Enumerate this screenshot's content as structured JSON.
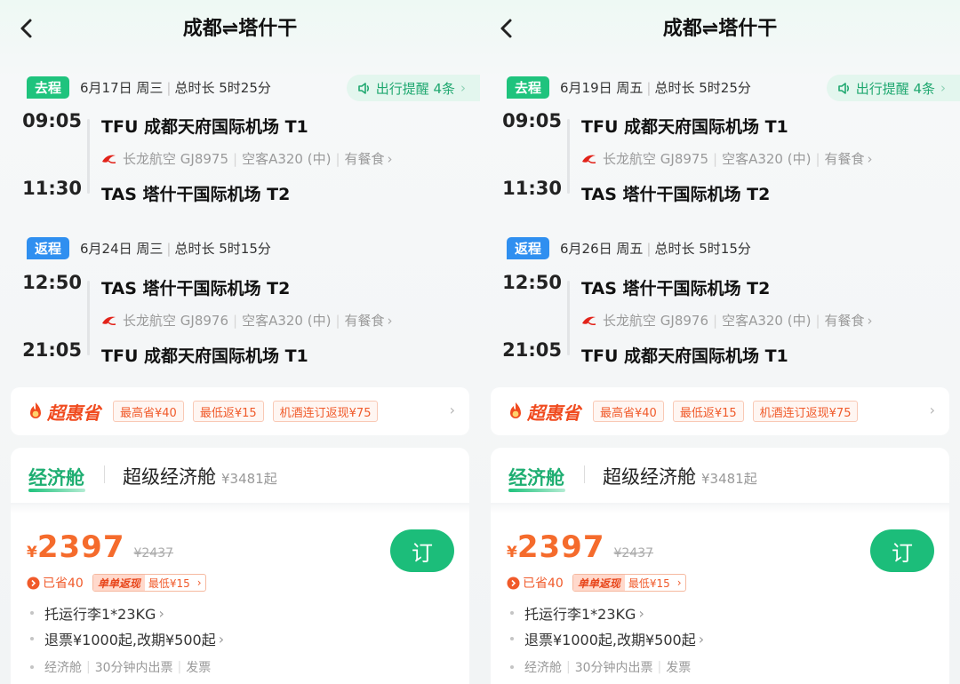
{
  "colors": {
    "go_badge": "#1fc37d",
    "return_badge": "#2f8ff0",
    "price": "#f56b2c",
    "book_button": "#1cbd7a"
  },
  "icons": {
    "back": "chevron-left-icon",
    "speaker": "speaker-icon",
    "airline": "airline-logo-icon",
    "promo": "flame-coin-icon"
  },
  "panels": [
    {
      "route_title": "成都⇌塔什干",
      "outbound": {
        "badge": "去程",
        "date": "6月17日 周三",
        "duration": "总时长 5时25分",
        "reminder": "出行提醒 4条",
        "dep_time": "09:05",
        "dep_airport": "TFU 成都天府国际机场 T1",
        "airline": "长龙航空 GJ8975",
        "aircraft": "空客A320 (中)",
        "meal": "有餐食",
        "arr_time": "11:30",
        "arr_airport": "TAS 塔什干国际机场 T2"
      },
      "inbound": {
        "badge": "返程",
        "date": "6月24日 周三",
        "duration": "总时长 5时15分",
        "dep_time": "12:50",
        "dep_airport": "TAS 塔什干国际机场 T2",
        "airline": "长龙航空 GJ8976",
        "aircraft": "空客A320 (中)",
        "meal": "有餐食",
        "arr_time": "21:05",
        "arr_airport": "TFU 成都天府国际机场 T1"
      },
      "promo": {
        "logo": "超惠省",
        "tags": [
          "最高省¥40",
          "最低返¥15",
          "机酒连订返现¥75"
        ]
      },
      "cabin": {
        "tab_economy": "经济舱",
        "tab_super": "超级经济舱",
        "super_price": "¥3481起",
        "currency": "¥",
        "price": "2397",
        "original_price": "¥2437",
        "saved": "已省40",
        "rebate_label": "单单返现",
        "rebate_value": "最低¥15",
        "book": "订",
        "baggage": "托运行李1*23KG",
        "refund": "退票¥1000起,改期¥500起",
        "class_note": "经济舱",
        "ticketing": "30分钟内出票",
        "invoice": "发票"
      }
    },
    {
      "route_title": "成都⇌塔什干",
      "outbound": {
        "badge": "去程",
        "date": "6月19日 周五",
        "duration": "总时长 5时25分",
        "reminder": "出行提醒 4条",
        "dep_time": "09:05",
        "dep_airport": "TFU 成都天府国际机场 T1",
        "airline": "长龙航空 GJ8975",
        "aircraft": "空客A320 (中)",
        "meal": "有餐食",
        "arr_time": "11:30",
        "arr_airport": "TAS 塔什干国际机场 T2"
      },
      "inbound": {
        "badge": "返程",
        "date": "6月26日 周五",
        "duration": "总时长 5时15分",
        "dep_time": "12:50",
        "dep_airport": "TAS 塔什干国际机场 T2",
        "airline": "长龙航空 GJ8976",
        "aircraft": "空客A320 (中)",
        "meal": "有餐食",
        "arr_time": "21:05",
        "arr_airport": "TFU 成都天府国际机场 T1"
      },
      "promo": {
        "logo": "超惠省",
        "tags": [
          "最高省¥40",
          "最低返¥15",
          "机酒连订返现¥75"
        ]
      },
      "cabin": {
        "tab_economy": "经济舱",
        "tab_super": "超级经济舱",
        "super_price": "¥3481起",
        "currency": "¥",
        "price": "2397",
        "original_price": "¥2437",
        "saved": "已省40",
        "rebate_label": "单单返现",
        "rebate_value": "最低¥15",
        "book": "订",
        "baggage": "托运行李1*23KG",
        "refund": "退票¥1000起,改期¥500起",
        "class_note": "经济舱",
        "ticketing": "30分钟内出票",
        "invoice": "发票"
      }
    }
  ]
}
